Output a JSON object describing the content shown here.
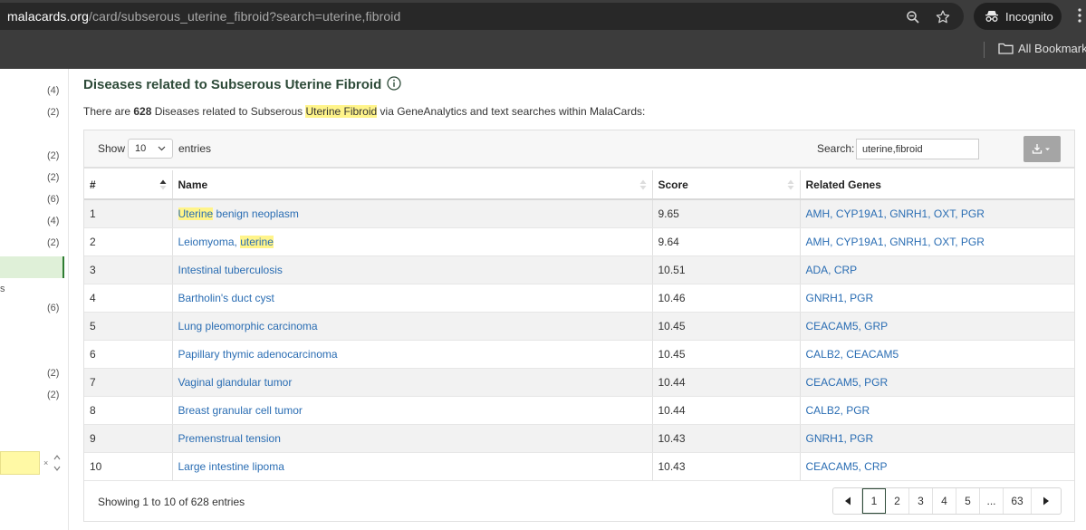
{
  "browser": {
    "url_host": "malacards.org",
    "url_path": "/card/subserous_uterine_fibroid?search=uterine,fibroid",
    "incognito_label": "Incognito",
    "bookmarks_label": "All Bookmarks"
  },
  "sidebar": {
    "counts": [
      "(4)",
      "(2)",
      "(2)",
      "(2)",
      "(6)",
      "(4)",
      "(2)",
      "(6)",
      "(2)",
      "(2)"
    ],
    "truncated_label": "s",
    "clear_symbol": "×"
  },
  "section": {
    "title": "Diseases related to Subserous Uterine Fibroid",
    "intro_prefix": "There are ",
    "intro_count": "628",
    "intro_mid": " Diseases related to Subserous ",
    "intro_highlight": "Uterine Fibroid",
    "intro_suffix": " via GeneAnalytics and text searches within MalaCards:"
  },
  "table_controls": {
    "show_label": "Show",
    "page_length": "10",
    "entries_label": "entries",
    "search_label": "Search:",
    "search_value": "uterine,fibroid"
  },
  "table": {
    "columns": [
      "#",
      "Name",
      "Score",
      "Related Genes"
    ],
    "rows": [
      {
        "num": "1",
        "name_hl": "Uterine",
        "name_rest": " benign neoplasm",
        "name_pre": "",
        "score": "9.65",
        "genes": "AMH, CYP19A1, GNRH1, OXT, PGR"
      },
      {
        "num": "2",
        "name_pre": "Leiomyoma, ",
        "name_hl": "uterine",
        "name_rest": "",
        "score": "9.64",
        "genes": "AMH, CYP19A1, GNRH1, OXT, PGR"
      },
      {
        "num": "3",
        "name": "Intestinal tuberculosis",
        "score": "10.51",
        "genes": "ADA, CRP"
      },
      {
        "num": "4",
        "name": "Bartholin's duct cyst",
        "score": "10.46",
        "genes": "GNRH1, PGR"
      },
      {
        "num": "5",
        "name": "Lung pleomorphic carcinoma",
        "score": "10.45",
        "genes": "CEACAM5, GRP"
      },
      {
        "num": "6",
        "name": "Papillary thymic adenocarcinoma",
        "score": "10.45",
        "genes": "CALB2, CEACAM5"
      },
      {
        "num": "7",
        "name": "Vaginal glandular tumor",
        "score": "10.44",
        "genes": "CEACAM5, PGR"
      },
      {
        "num": "8",
        "name": "Breast granular cell tumor",
        "score": "10.44",
        "genes": "CALB2, PGR"
      },
      {
        "num": "9",
        "name": "Premenstrual tension",
        "score": "10.43",
        "genes": "GNRH1, PGR"
      },
      {
        "num": "10",
        "name": "Large intestine lipoma",
        "score": "10.43",
        "genes": "CEACAM5, CRP"
      }
    ]
  },
  "footer": {
    "info": "Showing 1 to 10 of 628 entries",
    "pages": [
      "1",
      "2",
      "3",
      "4",
      "5",
      "...",
      "63"
    ],
    "current_page": "1"
  },
  "colors": {
    "heading": "#2e4b39",
    "link": "#2a6db3",
    "highlight": "#fff48a"
  }
}
